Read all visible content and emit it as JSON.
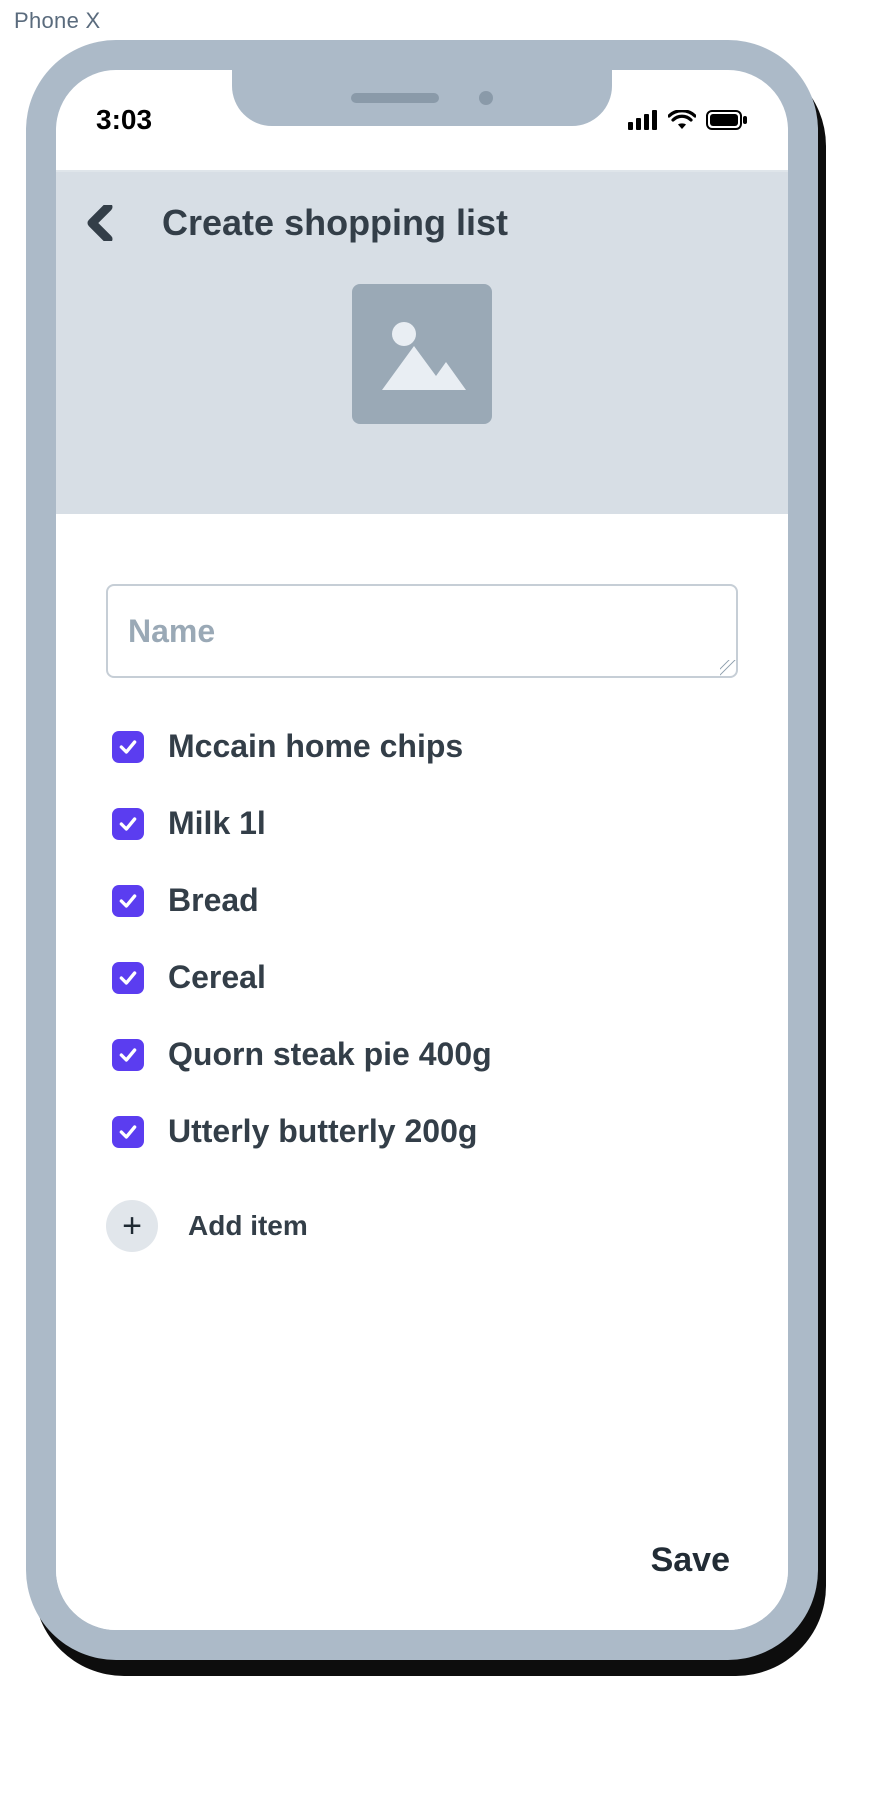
{
  "frame": {
    "device_label": "Phone X"
  },
  "status": {
    "time": "3:03"
  },
  "header": {
    "title": "Create shopping list"
  },
  "form": {
    "name_value": "",
    "name_placeholder": "Name"
  },
  "items": [
    {
      "label": "Mccain home chips",
      "checked": true
    },
    {
      "label": "Milk 1l",
      "checked": true
    },
    {
      "label": "Bread",
      "checked": true
    },
    {
      "label": "Cereal",
      "checked": true
    },
    {
      "label": "Quorn steak pie 400g",
      "checked": true
    },
    {
      "label": "Utterly butterly 200g",
      "checked": true
    }
  ],
  "actions": {
    "add_item_label": "Add item",
    "save_label": "Save"
  },
  "colors": {
    "accent": "#5b3df0",
    "frame": "#acbac8",
    "header_bg": "#d7dee5"
  }
}
